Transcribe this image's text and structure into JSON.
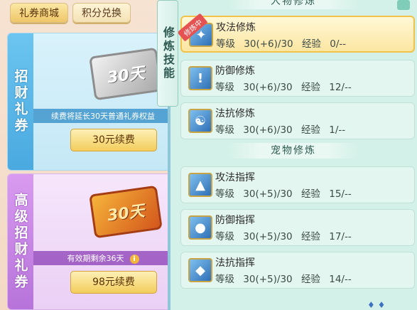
{
  "tabs": [
    {
      "label": "礼券商城",
      "active": true
    },
    {
      "label": "积分兑换",
      "active": false
    }
  ],
  "cards": [
    {
      "band": "招财礼券",
      "ticket_text": "30天",
      "note": "续费将延长30天普通礼券权益",
      "button": "30元续费"
    },
    {
      "band": "高级招财礼券",
      "ticket_text": "30天",
      "note": "有效期剩余36天",
      "button": "98元续费",
      "info_icon": "info-icon"
    }
  ],
  "ribbon_label": "修炼技能",
  "sections": {
    "character": "人物修炼",
    "pet": "宠物修炼"
  },
  "labels": {
    "level": "等级",
    "exp": "经验",
    "selected_badge": "修炼中"
  },
  "skills": [
    {
      "name": "攻法修炼",
      "level": "30(+6)/30",
      "exp": "0/--",
      "icon": "attack-magic-icon",
      "selected": true
    },
    {
      "name": "防御修炼",
      "level": "30(+6)/30",
      "exp": "12/--",
      "icon": "defense-icon",
      "selected": false
    },
    {
      "name": "法抗修炼",
      "level": "30(+6)/30",
      "exp": "1/--",
      "icon": "resist-magic-icon",
      "selected": false
    },
    {
      "name": "攻法指挥",
      "level": "30(+5)/30",
      "exp": "15/--",
      "icon": "pet-attack-icon",
      "selected": false
    },
    {
      "name": "防御指挥",
      "level": "30(+5)/30",
      "exp": "17/--",
      "icon": "pet-defense-icon",
      "selected": false
    },
    {
      "name": "法抗指挥",
      "level": "30(+5)/30",
      "exp": "14/--",
      "icon": "pet-resist-icon",
      "selected": false
    }
  ]
}
